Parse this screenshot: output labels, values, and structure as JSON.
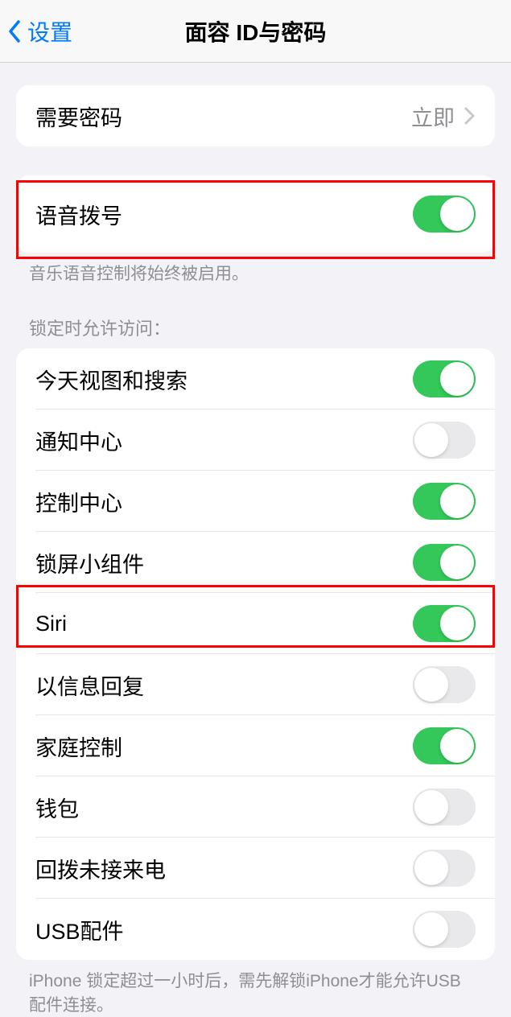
{
  "header": {
    "back_label": "设置",
    "title": "面容 ID与密码"
  },
  "sections": {
    "require_passcode": {
      "label": "需要密码",
      "value": "立即"
    },
    "voice_dial": {
      "label": "语音拨号",
      "on": true,
      "footer": "音乐语音控制将始终被启用。"
    },
    "lock_access": {
      "header": "锁定时允许访问：",
      "items": [
        {
          "label": "今天视图和搜索",
          "on": true
        },
        {
          "label": "通知中心",
          "on": false
        },
        {
          "label": "控制中心",
          "on": true
        },
        {
          "label": "锁屏小组件",
          "on": true
        },
        {
          "label": "Siri",
          "on": true
        },
        {
          "label": "以信息回复",
          "on": false
        },
        {
          "label": "家庭控制",
          "on": true
        },
        {
          "label": "钱包",
          "on": false
        },
        {
          "label": "回拨未接来电",
          "on": false
        },
        {
          "label": "USB配件",
          "on": false
        }
      ],
      "footer": "iPhone 锁定超过一小时后，需先解锁iPhone才能允许USB 配件连接。"
    }
  }
}
